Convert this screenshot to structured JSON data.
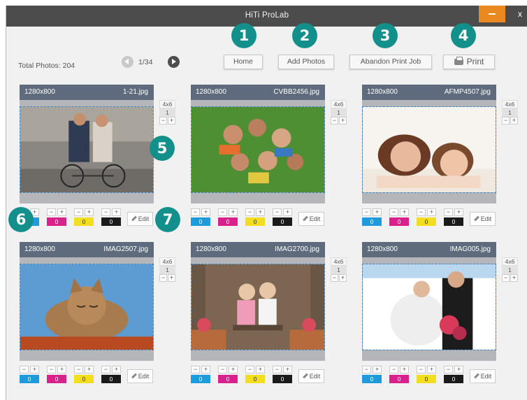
{
  "window": {
    "title": "HiTi ProLab",
    "minimize_icon": "minimize-icon",
    "close_label": "x"
  },
  "toolbar": {
    "total_photos": "Total Photos: 204",
    "page": "1/34",
    "home_label": "Home",
    "add_photos_label": "Add Photos",
    "abandon_label": "Abandon Print Job",
    "print_label": "Print"
  },
  "callouts": [
    "1",
    "2",
    "3",
    "4",
    "5",
    "6",
    "7"
  ],
  "cards": [
    {
      "resolution": "1280x800",
      "filename": "1-21.jpg",
      "size": "4x6",
      "copies": "1",
      "c": "0",
      "m": "0",
      "y": "0",
      "k": "0",
      "edit": "Edit",
      "subject": "couple-on-bicycle"
    },
    {
      "resolution": "1280x800",
      "filename": "CVBB2456.jpg",
      "size": "4x6",
      "copies": "1",
      "c": "0",
      "m": "0",
      "y": "0",
      "k": "0",
      "edit": "Edit",
      "subject": "friends-selfie-grass"
    },
    {
      "resolution": "1280x800",
      "filename": "AFMP4507.jpg",
      "size": "4x6",
      "copies": "1",
      "c": "0",
      "m": "0",
      "y": "0",
      "k": "0",
      "edit": "Edit",
      "subject": "mother-and-child"
    },
    {
      "resolution": "1280x800",
      "filename": "IMAG2507.jpg",
      "size": "4x6",
      "copies": "1",
      "c": "0",
      "m": "0",
      "y": "0",
      "k": "0",
      "edit": "Edit",
      "subject": "kitten"
    },
    {
      "resolution": "1280x800",
      "filename": "IMAG2700.jpg",
      "size": "4x6",
      "copies": "1",
      "c": "0",
      "m": "0",
      "y": "0",
      "k": "0",
      "edit": "Edit",
      "subject": "two-girls-on-bench"
    },
    {
      "resolution": "1280x800",
      "filename": "IMAG005.jpg",
      "size": "4x6",
      "copies": "1",
      "c": "0",
      "m": "0",
      "y": "0",
      "k": "0",
      "edit": "Edit",
      "subject": "wedding-couple"
    }
  ],
  "colors": {
    "accent": "#14908c",
    "header": "#5e6b7d",
    "minimize": "#e9891f",
    "cyan": "#1f9bdb",
    "magenta": "#d9218b",
    "yellow": "#f2de1c",
    "black": "#1a1a1a"
  }
}
